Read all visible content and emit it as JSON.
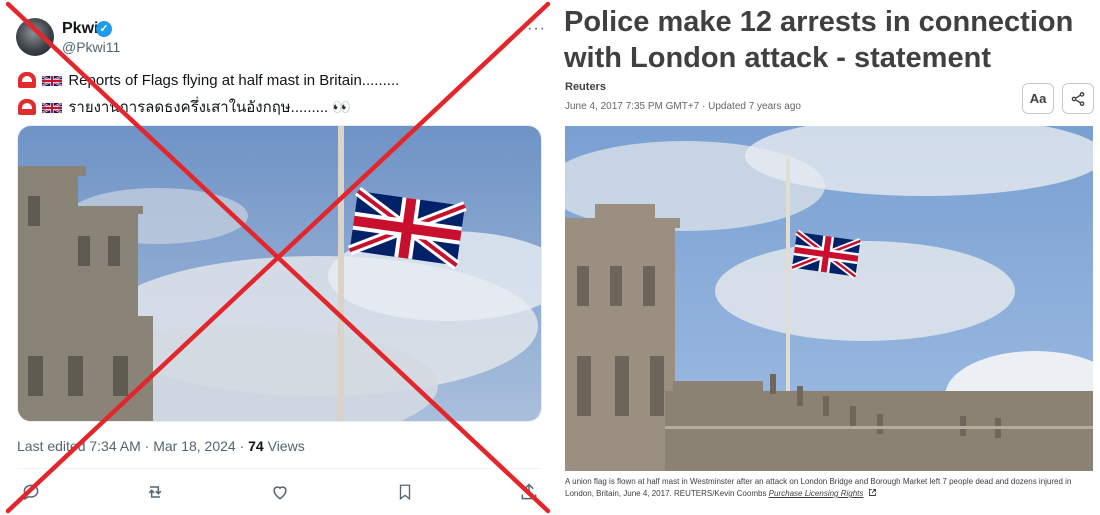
{
  "tweet": {
    "author": {
      "name": "Pkwi",
      "handle": "@Pkwi11"
    },
    "lines": [
      "Reports of Flags flying at half mast in Britain.........",
      "รายงานการลดธงครึ่งเสาในอังกฤษ......... 👀"
    ],
    "meta": {
      "edited": "Last edited 7:34 AM · Mar 18, 2024 · ",
      "views_count": "74",
      "views_label": " Views"
    },
    "actions": [
      "reply-icon",
      "retweet-icon",
      "like-icon",
      "bookmark-icon",
      "share-icon"
    ],
    "icons": {
      "verified": "✓",
      "more": "···"
    },
    "overlay_color": "#e3262b"
  },
  "article": {
    "headline": "Police make 12 arrests in connection with London attack - statement",
    "source": "Reuters",
    "dateline": "June 4, 2017 7:35 PM GMT+7 · Updated 7 years ago",
    "text_size_label": "Aa",
    "caption": "A union flag is flown at half mast in Westminster after an attack on London Bridge and Borough Market left 7 people dead and dozens injured in London, Britain, June 4, 2017. REUTERS/Kevin Coombs ",
    "license_label": "Purchase Licensing Rights"
  }
}
